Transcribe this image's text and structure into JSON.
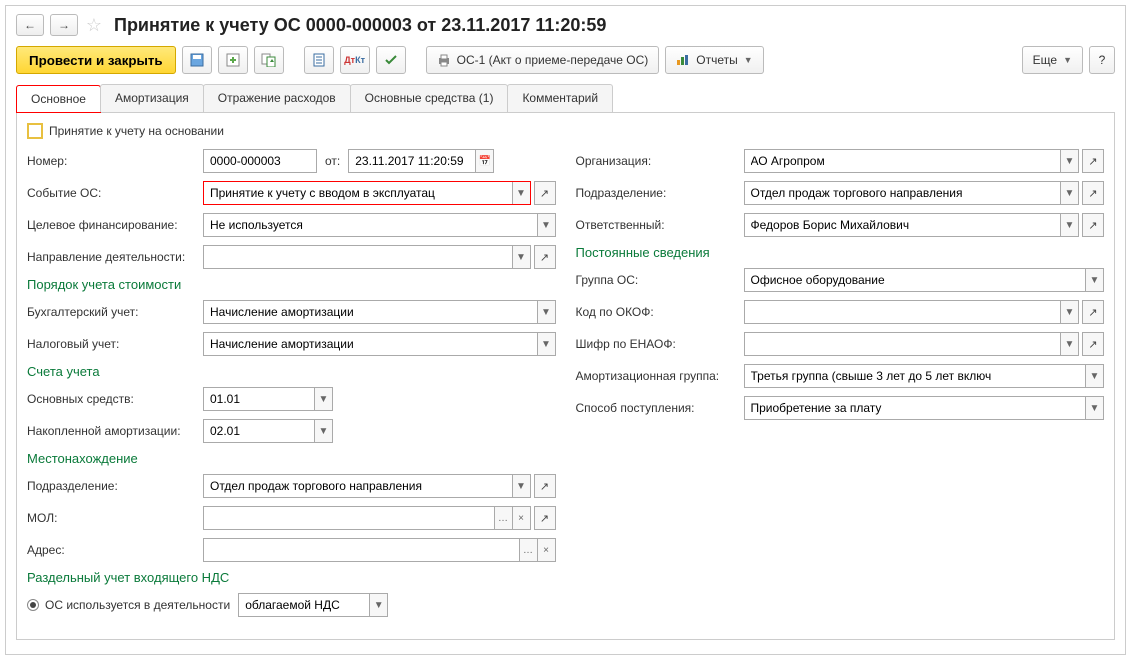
{
  "title": "Принятие к учету ОС 0000-000003 от 23.11.2017 11:20:59",
  "toolbar": {
    "main": "Провести и закрыть",
    "print": "ОС-1 (Акт о приеме-передаче ОС)",
    "reports": "Отчеты",
    "more": "Еще",
    "help": "?"
  },
  "tabs": {
    "t1": "Основное",
    "t2": "Амортизация",
    "t3": "Отражение расходов",
    "t4": "Основные средства (1)",
    "t5": "Комментарий"
  },
  "checkbox_label": "Принятие к учету на основании",
  "left": {
    "number_label": "Номер:",
    "number": "0000-000003",
    "date_label": "от:",
    "date": "23.11.2017 11:20:59",
    "event_label": "Событие ОС:",
    "event": "Принятие к учету с вводом в эксплуатац",
    "funding_label": "Целевое финансирование:",
    "funding": "Не используется",
    "activity_label": "Направление деятельности:",
    "sec1": "Порядок учета стоимости",
    "bu_label": "Бухгалтерский учет:",
    "bu": "Начисление амортизации",
    "nu_label": "Налоговый учет:",
    "nu": "Начисление амортизации",
    "sec2": "Счета учета",
    "acc_main_label": "Основных средств:",
    "acc_main": "01.01",
    "acc_dep_label": "Накопленной амортизации:",
    "acc_dep": "02.01",
    "sec3": "Местонахождение",
    "dept_label": "Подразделение:",
    "dept": "Отдел продаж торгового направления",
    "mol_label": "МОЛ:",
    "addr_label": "Адрес:",
    "sec4": "Раздельный учет входящего НДС",
    "radio_label": "ОС используется в деятельности",
    "nds_select": "облагаемой НДС"
  },
  "right": {
    "org_label": "Организация:",
    "org": "АО Агропром",
    "dept_label": "Подразделение:",
    "dept": "Отдел продаж торгового направления",
    "resp_label": "Ответственный:",
    "resp": "Федоров Борис Михайлович",
    "sec1": "Постоянные сведения",
    "group_label": "Группа ОС:",
    "group": "Офисное оборудование",
    "okof_label": "Код по ОКОФ:",
    "enaof_label": "Шифр по ЕНАОФ:",
    "amort_label": "Амортизационная группа:",
    "amort": "Третья группа (свыше 3 лет до 5 лет включ",
    "acq_label": "Способ поступления:",
    "acq": "Приобретение за плату"
  }
}
